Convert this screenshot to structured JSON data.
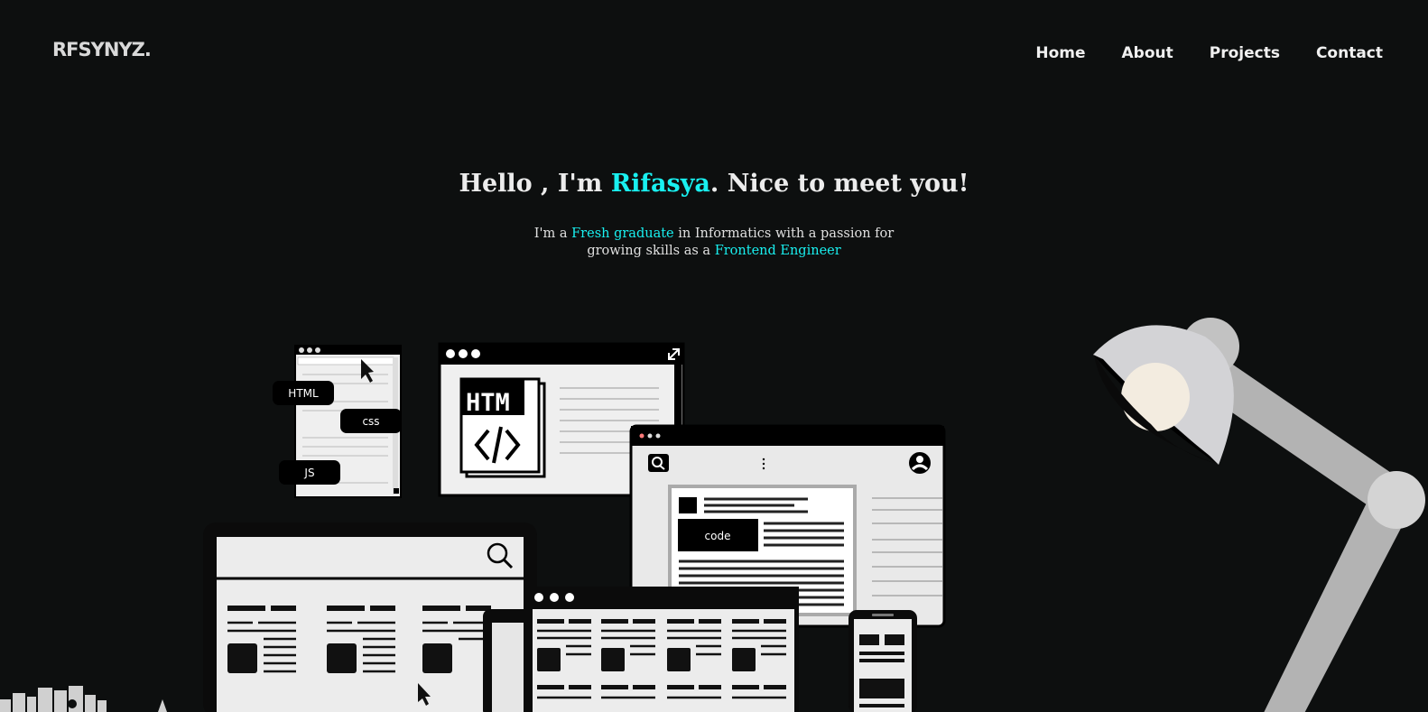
{
  "brand": {
    "logo": "RFSYNYZ."
  },
  "nav": {
    "items": [
      "Home",
      "About",
      "Projects",
      "Contact"
    ]
  },
  "hero": {
    "title_pre": "Hello , I'm ",
    "title_name": "Rifasya",
    "title_post": ". Nice to meet you!",
    "sub_pre": "I'm a ",
    "sub_accent1": "Fresh graduate",
    "sub_mid": " in Informatics with a passion for growing skills as a ",
    "sub_accent2": "Frontend Engineer"
  },
  "illustration": {
    "tags": {
      "html": "HTML",
      "css": "css",
      "js": "JS"
    },
    "code_label": "code",
    "html_file_label": "HTM"
  },
  "colors": {
    "accent": "#19f0f0",
    "background": "#0d0f0f"
  }
}
